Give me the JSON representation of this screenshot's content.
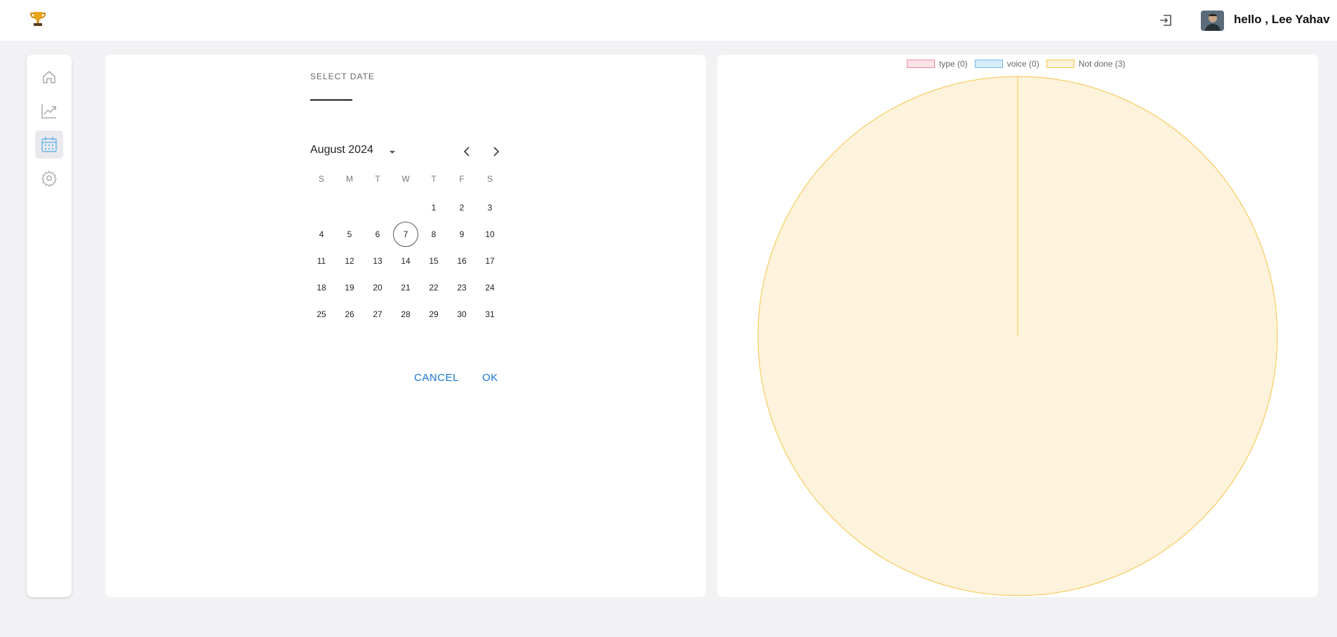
{
  "header": {
    "logo_icon": "trophy-icon",
    "logout_icon": "logout-icon",
    "greeting": "hello , Lee Yahav"
  },
  "sidebar": {
    "items": [
      {
        "name": "home",
        "icon": "home-icon",
        "active": false
      },
      {
        "name": "stats",
        "icon": "trending-up-icon",
        "active": false
      },
      {
        "name": "calendar",
        "icon": "calendar-icon",
        "active": true
      },
      {
        "name": "settings",
        "icon": "gear-icon",
        "active": false
      }
    ]
  },
  "datepicker": {
    "label": "SELECT DATE",
    "selected_value": "——",
    "month_year": "August 2024",
    "weekdays": [
      "S",
      "M",
      "T",
      "W",
      "T",
      "F",
      "S"
    ],
    "first_weekday_offset": 4,
    "days_in_month": 31,
    "today": 7,
    "cancel_label": "CANCEL",
    "ok_label": "OK"
  },
  "chart_data": {
    "type": "pie",
    "legend_position": "top",
    "series": [
      {
        "name": "type (0)",
        "value": 0,
        "fill": "#fde2e7",
        "stroke": "#f08aa0"
      },
      {
        "name": "voice (0)",
        "value": 0,
        "fill": "#d6ecfb",
        "stroke": "#72b8ea"
      },
      {
        "name": "Not done (3)",
        "value": 3,
        "fill": "#fdf3dc",
        "stroke": "#f6c445"
      }
    ]
  }
}
